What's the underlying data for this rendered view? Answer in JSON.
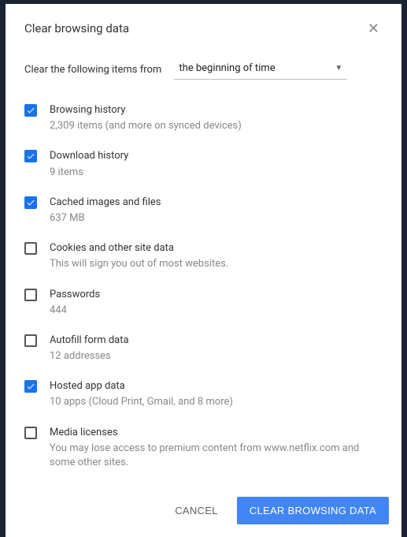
{
  "dialog": {
    "title": "Clear browsing data",
    "timerange": {
      "label": "Clear the following items from",
      "value": "the beginning of time"
    },
    "items": [
      {
        "title": "Browsing history",
        "sub": "2,309 items (and more on synced devices)",
        "checked": true
      },
      {
        "title": "Download history",
        "sub": "9 items",
        "checked": true
      },
      {
        "title": "Cached images and files",
        "sub": "637 MB",
        "checked": true
      },
      {
        "title": "Cookies and other site data",
        "sub": "This will sign you out of most websites.",
        "checked": false
      },
      {
        "title": "Passwords",
        "sub": "444",
        "checked": false
      },
      {
        "title": "Autofill form data",
        "sub": "12 addresses",
        "checked": false
      },
      {
        "title": "Hosted app data",
        "sub": "10 apps (Cloud Print, Gmail, and 8 more)",
        "checked": true
      },
      {
        "title": "Media licenses",
        "sub": "You may lose access to premium content from www.netflix.com and some other sites.",
        "checked": false
      }
    ],
    "buttons": {
      "cancel": "CANCEL",
      "clear": "CLEAR BROWSING DATA"
    }
  }
}
